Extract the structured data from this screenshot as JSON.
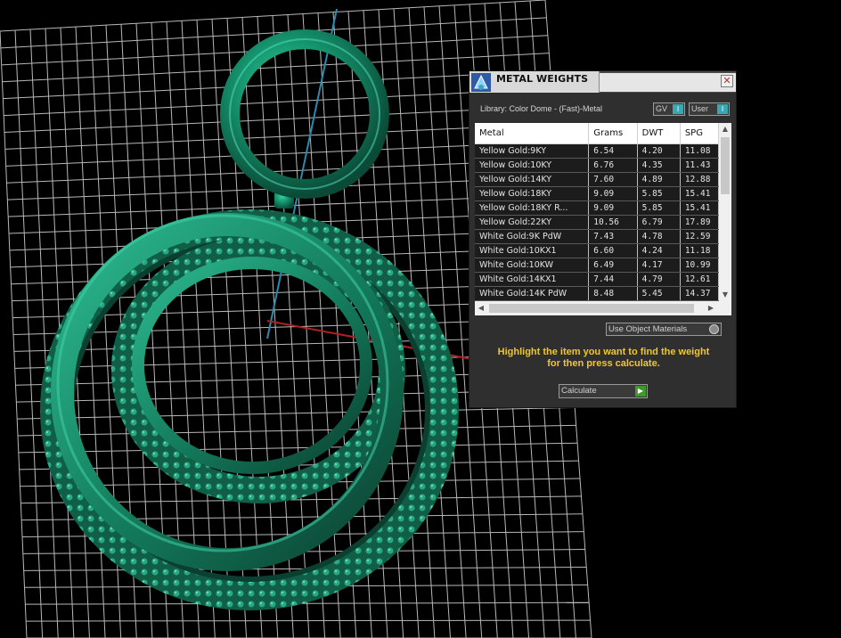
{
  "viewport": {
    "model_color": "#137a5a",
    "grid_color": "#ffffff",
    "axis_colors": {
      "y": "#2a8bb0",
      "x": "#b02020"
    }
  },
  "panel": {
    "title": "METAL WEIGHTS",
    "close_label": "✕",
    "library_label": "Library: Color Dome - (Fast)-Metal",
    "toggles": {
      "gv": {
        "label": "GV",
        "knob": "I"
      },
      "user": {
        "label": "User",
        "knob": "I"
      }
    },
    "table": {
      "columns": [
        "Metal",
        "Grams",
        "DWT",
        "SPG"
      ],
      "rows": [
        [
          "Yellow Gold:9KY",
          "6.54",
          "4.20",
          "11.08"
        ],
        [
          "Yellow Gold:10KY",
          "6.76",
          "4.35",
          "11.43"
        ],
        [
          "Yellow Gold:14KY",
          "7.60",
          "4.89",
          "12.88"
        ],
        [
          "Yellow Gold:18KY",
          "9.09",
          "5.85",
          "15.41"
        ],
        [
          "Yellow Gold:18KY R...",
          "9.09",
          "5.85",
          "15.41"
        ],
        [
          "Yellow Gold:22KY",
          "10.56",
          "6.79",
          "17.89"
        ],
        [
          "White Gold:9K PdW",
          "7.43",
          "4.78",
          "12.59"
        ],
        [
          "White Gold:10KX1",
          "6.60",
          "4.24",
          "11.18"
        ],
        [
          "White Gold:10KW",
          "6.49",
          "4.17",
          "10.99"
        ],
        [
          "White Gold:14KX1",
          "7.44",
          "4.79",
          "12.61"
        ],
        [
          "White Gold:14K PdW",
          "8.48",
          "5.45",
          "14.37"
        ]
      ],
      "scroll_icons": {
        "up": "▲",
        "down": "▼",
        "left": "◀",
        "right": "▶"
      }
    },
    "use_materials_label": "Use Object Materials",
    "hint_line1": "Highlight the item you want to find the weight",
    "hint_line2": "for then press calculate.",
    "calculate_label": "Calculate",
    "calculate_icon": "▶",
    "accent_color": "#3aa8b4",
    "hint_color": "#f2c62c"
  }
}
